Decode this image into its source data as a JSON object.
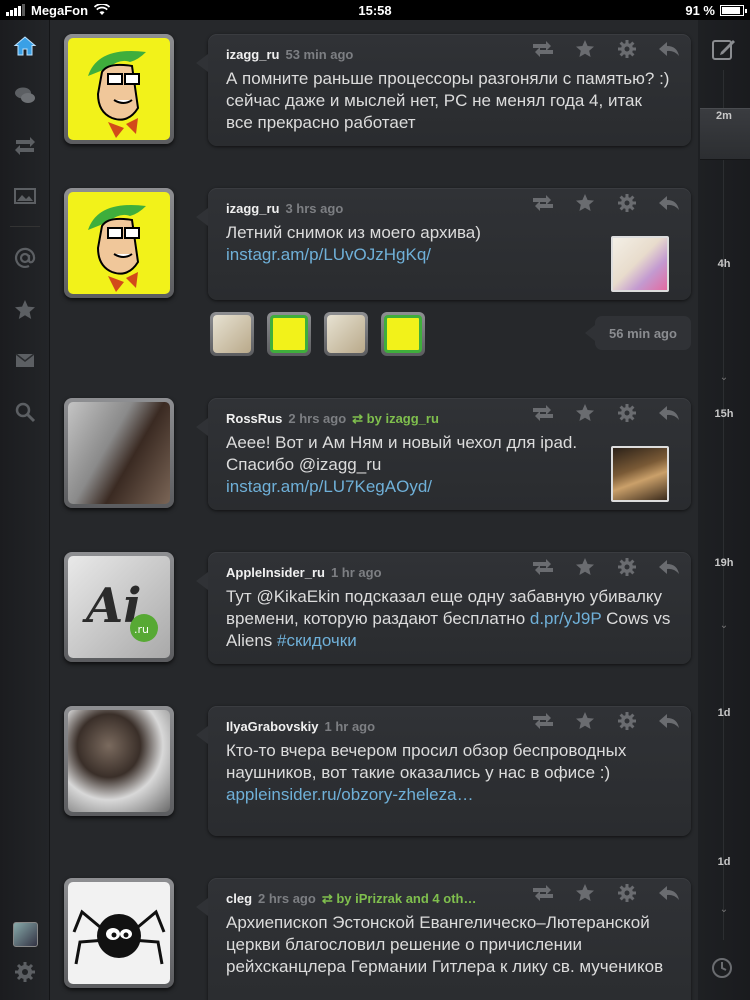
{
  "status_bar": {
    "carrier": "MegaFon",
    "time": "15:58",
    "battery": "91 %",
    "battery_level": 0.91
  },
  "colors": {
    "accent": "#3aa0e6",
    "link": "#6fb0d8",
    "retweet": "#7fbf4d"
  },
  "sidebar": {
    "items": [
      {
        "icon": "home-icon",
        "active": true
      },
      {
        "icon": "conversations-icon"
      },
      {
        "icon": "retweets-icon"
      },
      {
        "icon": "photos-icon"
      },
      {
        "icon": "mentions-icon"
      },
      {
        "icon": "favorites-icon"
      },
      {
        "icon": "messages-icon"
      },
      {
        "icon": "search-icon"
      }
    ],
    "footer": [
      "account-avatar",
      "settings-icon"
    ]
  },
  "timeline": {
    "labels": [
      "2m",
      "4h",
      "15h",
      "19h",
      "1d",
      "1d"
    ],
    "icons": [
      "compose-icon",
      "clock-icon"
    ]
  },
  "feed": {
    "tweets": [
      {
        "user": "izagg_ru",
        "time": "53 min ago",
        "rt": "",
        "text": "А помните раньше процессоры разгоняли с памятью? :) сейчас даже и мыслей нет, PC не менял года 4, итак все прекрасно работает",
        "link": "",
        "tail": ""
      },
      {
        "user": "izagg_ru",
        "time": "3 hrs ago",
        "rt": "",
        "text": "Летний снимок из моего архива)",
        "link": "instagr.am/p/LUvOJzHgKq/",
        "tail": ""
      },
      {
        "user": "RossRus",
        "time": "2 hrs ago",
        "rt": "by izagg_ru",
        "text": "Аеее! Вот и Ам Ням и новый чехол для ipad. Спасибо ",
        "mention": "@izagg_ru",
        "link": "instagr.am/p/LU7KegAOyd/",
        "tail": ""
      },
      {
        "user": "AppleInsider_ru",
        "time": "1 hr ago",
        "rt": "",
        "text_pre": "Тут ",
        "mention": "@KikaEkin",
        "text": " подсказал еще одну забавную убивалку времени, которую раздают бесплатно ",
        "link": "d.pr/yJ9P",
        "tail": " Cows vs Aliens ",
        "hashtag": "#скидочки"
      },
      {
        "user": "IlyaGrabovskiy",
        "time": "1 hr ago",
        "rt": "",
        "text": "Кто-то вчера вечером просил обзор беспроводных наушников, вот такие оказались у нас в офисе :)",
        "link": "appleinsider.ru/obzory-zheleza…",
        "tail": ""
      },
      {
        "user": "cleg",
        "time": "2 hrs ago",
        "rt": "by iPrizrak and 4 oth…",
        "text": "Архиепископ Эстонской Евангелическо–Лютеранской церкви благословил решение о причислении рейхсканцлера Германии Гитлера к лику св. мучеников",
        "link": "",
        "tail": ""
      }
    ],
    "gap": {
      "label": "56 min ago"
    }
  }
}
